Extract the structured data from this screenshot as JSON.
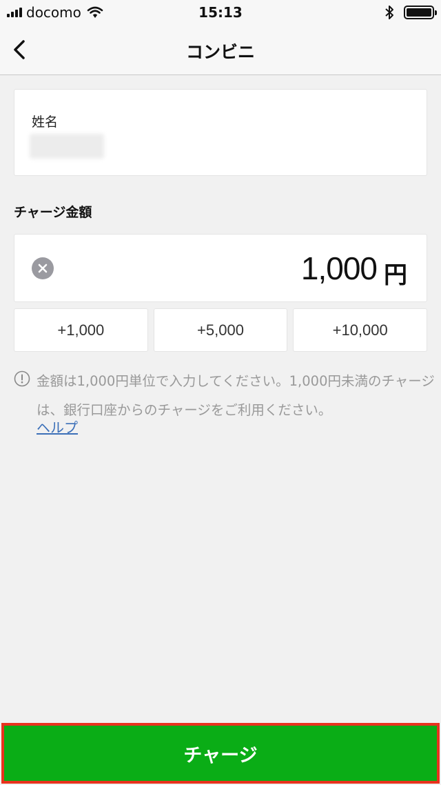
{
  "status_bar": {
    "carrier": "docomo",
    "time": "15:13"
  },
  "header": {
    "title": "コンビニ"
  },
  "name_card": {
    "label": "姓名"
  },
  "amount_section": {
    "label": "チャージ金額",
    "value": "1,000",
    "unit": "円"
  },
  "presets": [
    "+1,000",
    "+5,000",
    "+10,000"
  ],
  "notice": {
    "text": "金額は1,000円単位で入力してください。1,000円未満のチャージは、銀行口座からのチャージをご利用ください。",
    "help_link": "ヘルプ"
  },
  "footer": {
    "charge_label": "チャージ",
    "button_color": "#0aad16",
    "highlight_color": "#e8321e"
  }
}
